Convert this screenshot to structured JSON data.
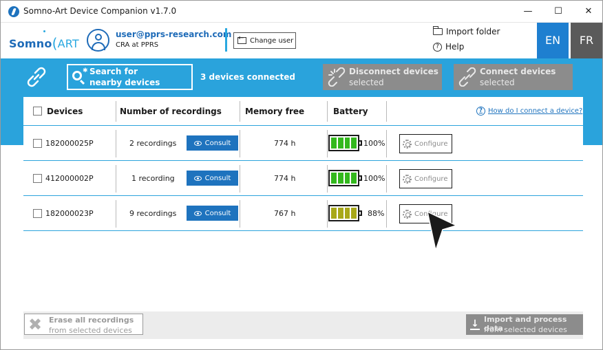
{
  "window": {
    "title": "Somno-Art Device Companion v1.7.0",
    "controls": [
      "—",
      "☐",
      "✕"
    ]
  },
  "header": {
    "logo_somno": "Somno",
    "logo_art": "ART",
    "user_email": "user@pprs-research.com",
    "user_role": "CRA at PPRS",
    "change_user_label": "Change user",
    "import_folder_label": "Import folder",
    "help_label": "Help",
    "languages": [
      "EN",
      "FR"
    ],
    "active_language": "EN"
  },
  "toolbar": {
    "search_line1": "Search for",
    "search_line2": "nearby devices",
    "connected_text": "3 devices connected",
    "disconnect_line1": "Disconnect devices",
    "disconnect_line2": "selected",
    "connect_line1": "Connect devices",
    "connect_line2": "selected"
  },
  "table": {
    "headers": {
      "devices": "Devices",
      "recordings": "Number of recordings",
      "memory": "Memory free",
      "battery": "Battery"
    },
    "how_to_connect": "How do I connect a device?",
    "consult_label": "Consult",
    "configure_label": "Configure",
    "rows": [
      {
        "device": "182000025P",
        "recordings": "2 recordings",
        "memory": "774 h",
        "battery_pct": "100%",
        "battery_level": 1.0,
        "battery_color": "#33b81d"
      },
      {
        "device": "412000002P",
        "recordings": "1 recording",
        "memory": "774 h",
        "battery_pct": "100%",
        "battery_level": 1.0,
        "battery_color": "#33b81d"
      },
      {
        "device": "182000023P",
        "recordings": "9 recordings",
        "memory": "767 h",
        "battery_pct": "88%",
        "battery_level": 0.88,
        "battery_color": "#a8a81a"
      }
    ]
  },
  "footer": {
    "erase_line1": "Erase all recordings",
    "erase_line2": "from selected devices",
    "import_line1": "Import and process data",
    "import_line2": "from selected devices"
  },
  "colors": {
    "accent_blue": "#2aa3dc",
    "brand_blue": "#1e6bb8",
    "disabled_grey": "#8c8c8c"
  }
}
